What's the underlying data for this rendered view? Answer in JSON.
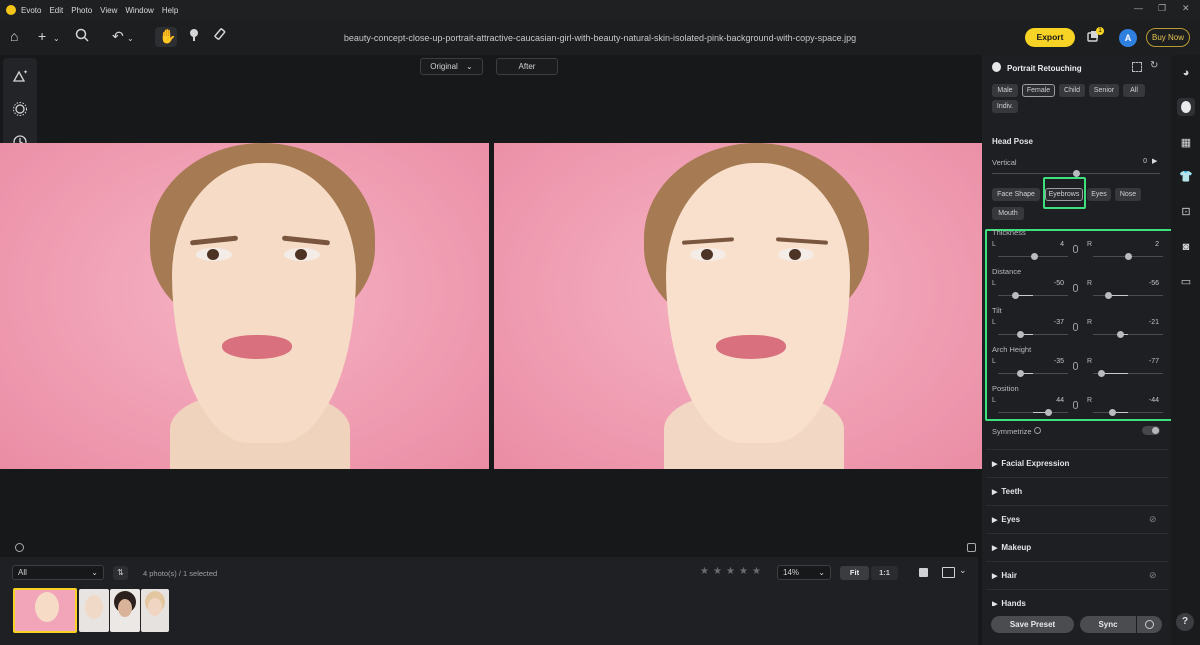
{
  "app": {
    "name": "Evoto",
    "menus": [
      "Edit",
      "Photo",
      "View",
      "Window",
      "Help"
    ],
    "window_controls": [
      "—",
      "❐",
      "✕"
    ]
  },
  "toolbar": {
    "filename": "beauty-concept-close-up-portrait-attractive-caucasian-girl-with-beauty-natural-skin-isolated-pink-background-with-copy-space.jpg",
    "export_label": "Export",
    "buy_now_label": "Buy Now",
    "notification_count": "1",
    "avatar_letter": "A"
  },
  "compare": {
    "original_label": "Original",
    "after_label": "After"
  },
  "filmstrip": {
    "filter_value": "All",
    "photo_count_text": "4 photo(s) / 1 selected",
    "zoom_value": "14%",
    "fit_label": "Fit",
    "one_to_one_label": "1:1",
    "rating_stars": 5
  },
  "panel": {
    "title": "Portrait Retouching",
    "gender_chips": [
      "Male",
      "Female",
      "Child",
      "Senior",
      "All",
      "Indiv."
    ],
    "selected_gender": "Female",
    "head_pose": {
      "title": "Head Pose",
      "vertical_label": "Vertical",
      "vertical_value": "0",
      "vertical_level": 0.5
    },
    "feature_chips": [
      "Face Shape",
      "Eyebrows",
      "Eyes",
      "Nose",
      "Mouth"
    ],
    "selected_feature": "Eyebrows",
    "eyebrow_params": [
      {
        "name": "Thickness",
        "left": "4",
        "right": "2"
      },
      {
        "name": "Distance",
        "left": "-50",
        "right": "-56"
      },
      {
        "name": "Tilt",
        "left": "-37",
        "right": "-21"
      },
      {
        "name": "Arch Height",
        "left": "-35",
        "right": "-77"
      },
      {
        "name": "Position",
        "left": "44",
        "right": "-44"
      }
    ],
    "side_labels": {
      "left": "L",
      "right": "R"
    },
    "symmetrize_label": "Symmetrize",
    "symmetrize_on": false,
    "sections": [
      "Facial Expression",
      "Teeth",
      "Eyes",
      "Makeup",
      "Hair",
      "Hands"
    ],
    "save_preset_label": "Save Preset",
    "sync_label": "Sync"
  },
  "colors": {
    "accent_yellow": "#f7d325",
    "highlight_green": "#3de07d",
    "avatar_blue": "#2f7fe0",
    "photo_pink": "#f2a4b8"
  }
}
